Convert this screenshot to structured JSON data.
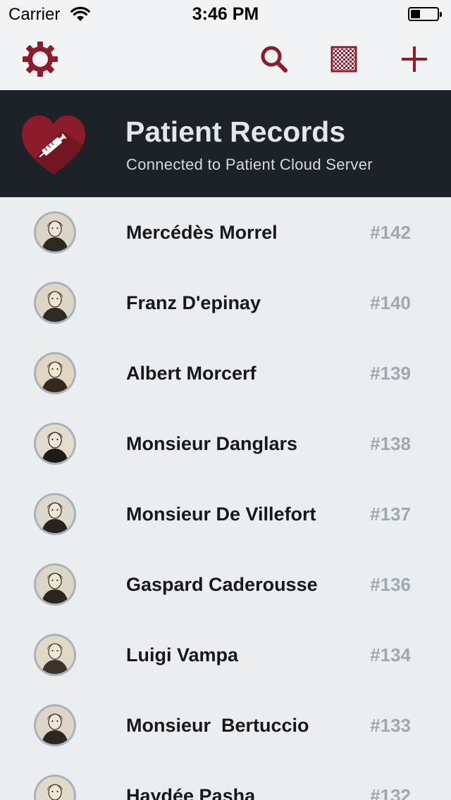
{
  "status_bar": {
    "carrier": "Carrier",
    "time": "3:46 PM"
  },
  "toolbar": {
    "icons": [
      "gear-icon",
      "search-icon",
      "qr-grid-icon",
      "plus-icon"
    ]
  },
  "header": {
    "title": "Patient Records",
    "subtitle": "Connected to Patient Cloud Server",
    "logo": "heart-syringe-logo"
  },
  "patients": [
    {
      "name": "Mercédès Morrel",
      "number": "#142"
    },
    {
      "name": "Franz D'epinay",
      "number": "#140"
    },
    {
      "name": "Albert Morcerf",
      "number": "#139"
    },
    {
      "name": "Monsieur Danglars",
      "number": "#138"
    },
    {
      "name": "Monsieur De Villefort",
      "number": "#137"
    },
    {
      "name": "Gaspard Caderousse",
      "number": "#136"
    },
    {
      "name": "Luigi Vampa",
      "number": "#134"
    },
    {
      "name": "Monsieur  Bertuccio",
      "number": "#133"
    },
    {
      "name": "Haydée Pasha",
      "number": "#132"
    }
  ],
  "colors": {
    "accent": "#8c1b2b",
    "header_bg": "#1d2128",
    "list_bg": "#ebeef1",
    "number": "#a3a8ae"
  }
}
